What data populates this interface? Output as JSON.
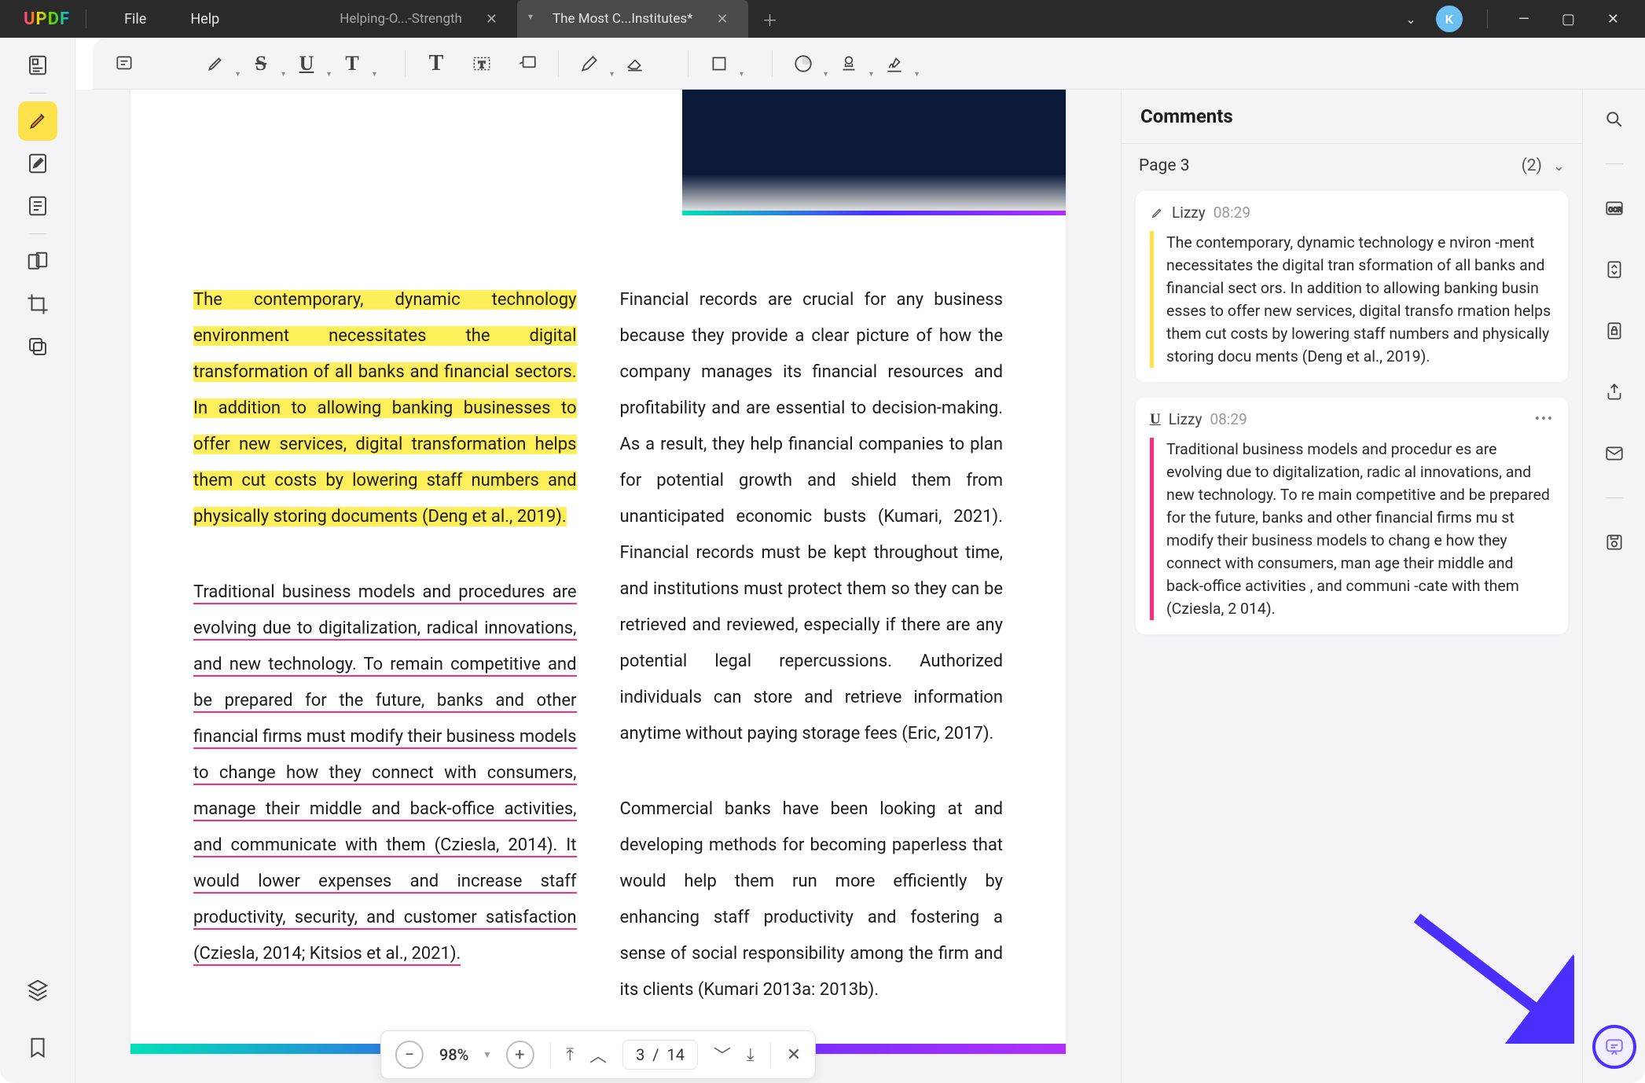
{
  "app": {
    "logo_prefix": "U",
    "logo_rest": "PDF",
    "avatar_letter": "K"
  },
  "menu": {
    "file": "File",
    "help": "Help"
  },
  "tabs": [
    {
      "label": "Helping-O...-Strength",
      "active": false
    },
    {
      "label": "The Most C...Institutes*",
      "active": true
    }
  ],
  "comments": {
    "title": "Comments",
    "page_label": "Page 3",
    "count": "(2)",
    "items": [
      {
        "user": "Lizzy",
        "time": "08:29",
        "bar": "y",
        "icon": "hl",
        "text": "The contemporary, dynamic technology e nviron -ment necessitates the digital tran sformation of all banks and financial sect ors. In addition to allowing banking busin esses to offer new services, digital transfo rmation helps them cut costs by lowering staff numbers and physically storing docu ments (Deng et al., 2019)."
      },
      {
        "user": "Lizzy",
        "time": "08:29",
        "bar": "r",
        "icon": "ul",
        "text": "Traditional business models and procedur es are evolving due to digitalization, radic al innovations, and new technology. To re main competitive and be prepared for the future, banks and other financial firms mu st modify their business models to chang e how they connect with consumers, man age their middle and back-office activities , and communi -cate with them (Cziesla, 2 014)."
      }
    ]
  },
  "doc": {
    "col1_hl": "The contemporary, dynamic technology environment necessitates the digital transformation of all banks and financial sectors. In addition to allowing banking businesses to offer new services, digital transformation helps them cut costs by lowering staff numbers and physically storing documents (Deng et al., 2019).",
    "col1_under": "Traditional business models and procedures are evolving due to digitalization, radical innovations, and new technology. To remain competitive and be prepared for the future, banks and other financial firms must modify their business models to change how they connect with consumers, manage their middle and back-office activities, and communicate with them (Cziesla, 2014).",
    "col1_plain": " It would lower expenses and increase staff productivity, security, and customer satisfaction (Cziesla, 2014; Kitsios et al., 2021).",
    "col2_p1": "Financial records are crucial for any business because they provide a clear picture of how the company manages its financial resources and profitability and are essential to decision-making. As a result, they help financial companies to plan for potential growth and shield them from unanticipated economic busts (Kumari, 2021). Financial records must be kept throughout time, and institutions must protect them so they can be retrieved and reviewed, especially if there are any potential legal repercussions. Authorized individuals can store and retrieve information anytime without paying storage fees (Eric, 2017).",
    "col2_p2": "Commercial banks have been looking at and developing methods for becoming paperless that would help them run more efficiently by enhancing staff productivity and fostering a sense of social responsibility among the firm and its clients (Kumari 2013a: 2013b)."
  },
  "page_ctrl": {
    "zoom": "98%",
    "current": "3",
    "sep": "/",
    "total": "14"
  }
}
